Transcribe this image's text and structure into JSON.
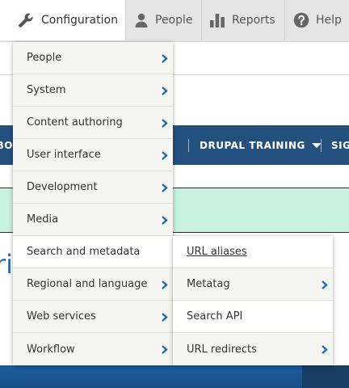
{
  "toolbar": {
    "configuration_label": "Configuration",
    "people_label": "People",
    "reports_label": "Reports",
    "help_label": "Help"
  },
  "page": {
    "nav_partial_left": "ABO",
    "nav_training": "DRUPAL TRAINING",
    "nav_partial_right": "SIG",
    "heading_partial": "ri"
  },
  "configuration_menu": {
    "items": [
      {
        "label": "People",
        "has_submenu": true
      },
      {
        "label": "System",
        "has_submenu": true
      },
      {
        "label": "Content authoring",
        "has_submenu": true
      },
      {
        "label": "User interface",
        "has_submenu": true
      },
      {
        "label": "Development",
        "has_submenu": true
      },
      {
        "label": "Media",
        "has_submenu": true
      },
      {
        "label": "Search and metadata",
        "has_submenu": true,
        "active": true
      },
      {
        "label": "Regional and language",
        "has_submenu": true
      },
      {
        "label": "Web services",
        "has_submenu": true
      },
      {
        "label": "Workflow",
        "has_submenu": true
      }
    ]
  },
  "search_metadata_submenu": {
    "items": [
      {
        "label": "URL aliases",
        "has_submenu": false,
        "hovered": true
      },
      {
        "label": "Metatag",
        "has_submenu": true
      },
      {
        "label": "Search API",
        "has_submenu": false
      },
      {
        "label": "URL redirects",
        "has_submenu": true
      }
    ]
  },
  "colors": {
    "toolbar_bg": "#e5e5e5",
    "navbar_bg": "#23507c",
    "alert_bg": "#c8f1e1",
    "chevron": "#1b6fb0",
    "heading": "#2c6fa7"
  }
}
